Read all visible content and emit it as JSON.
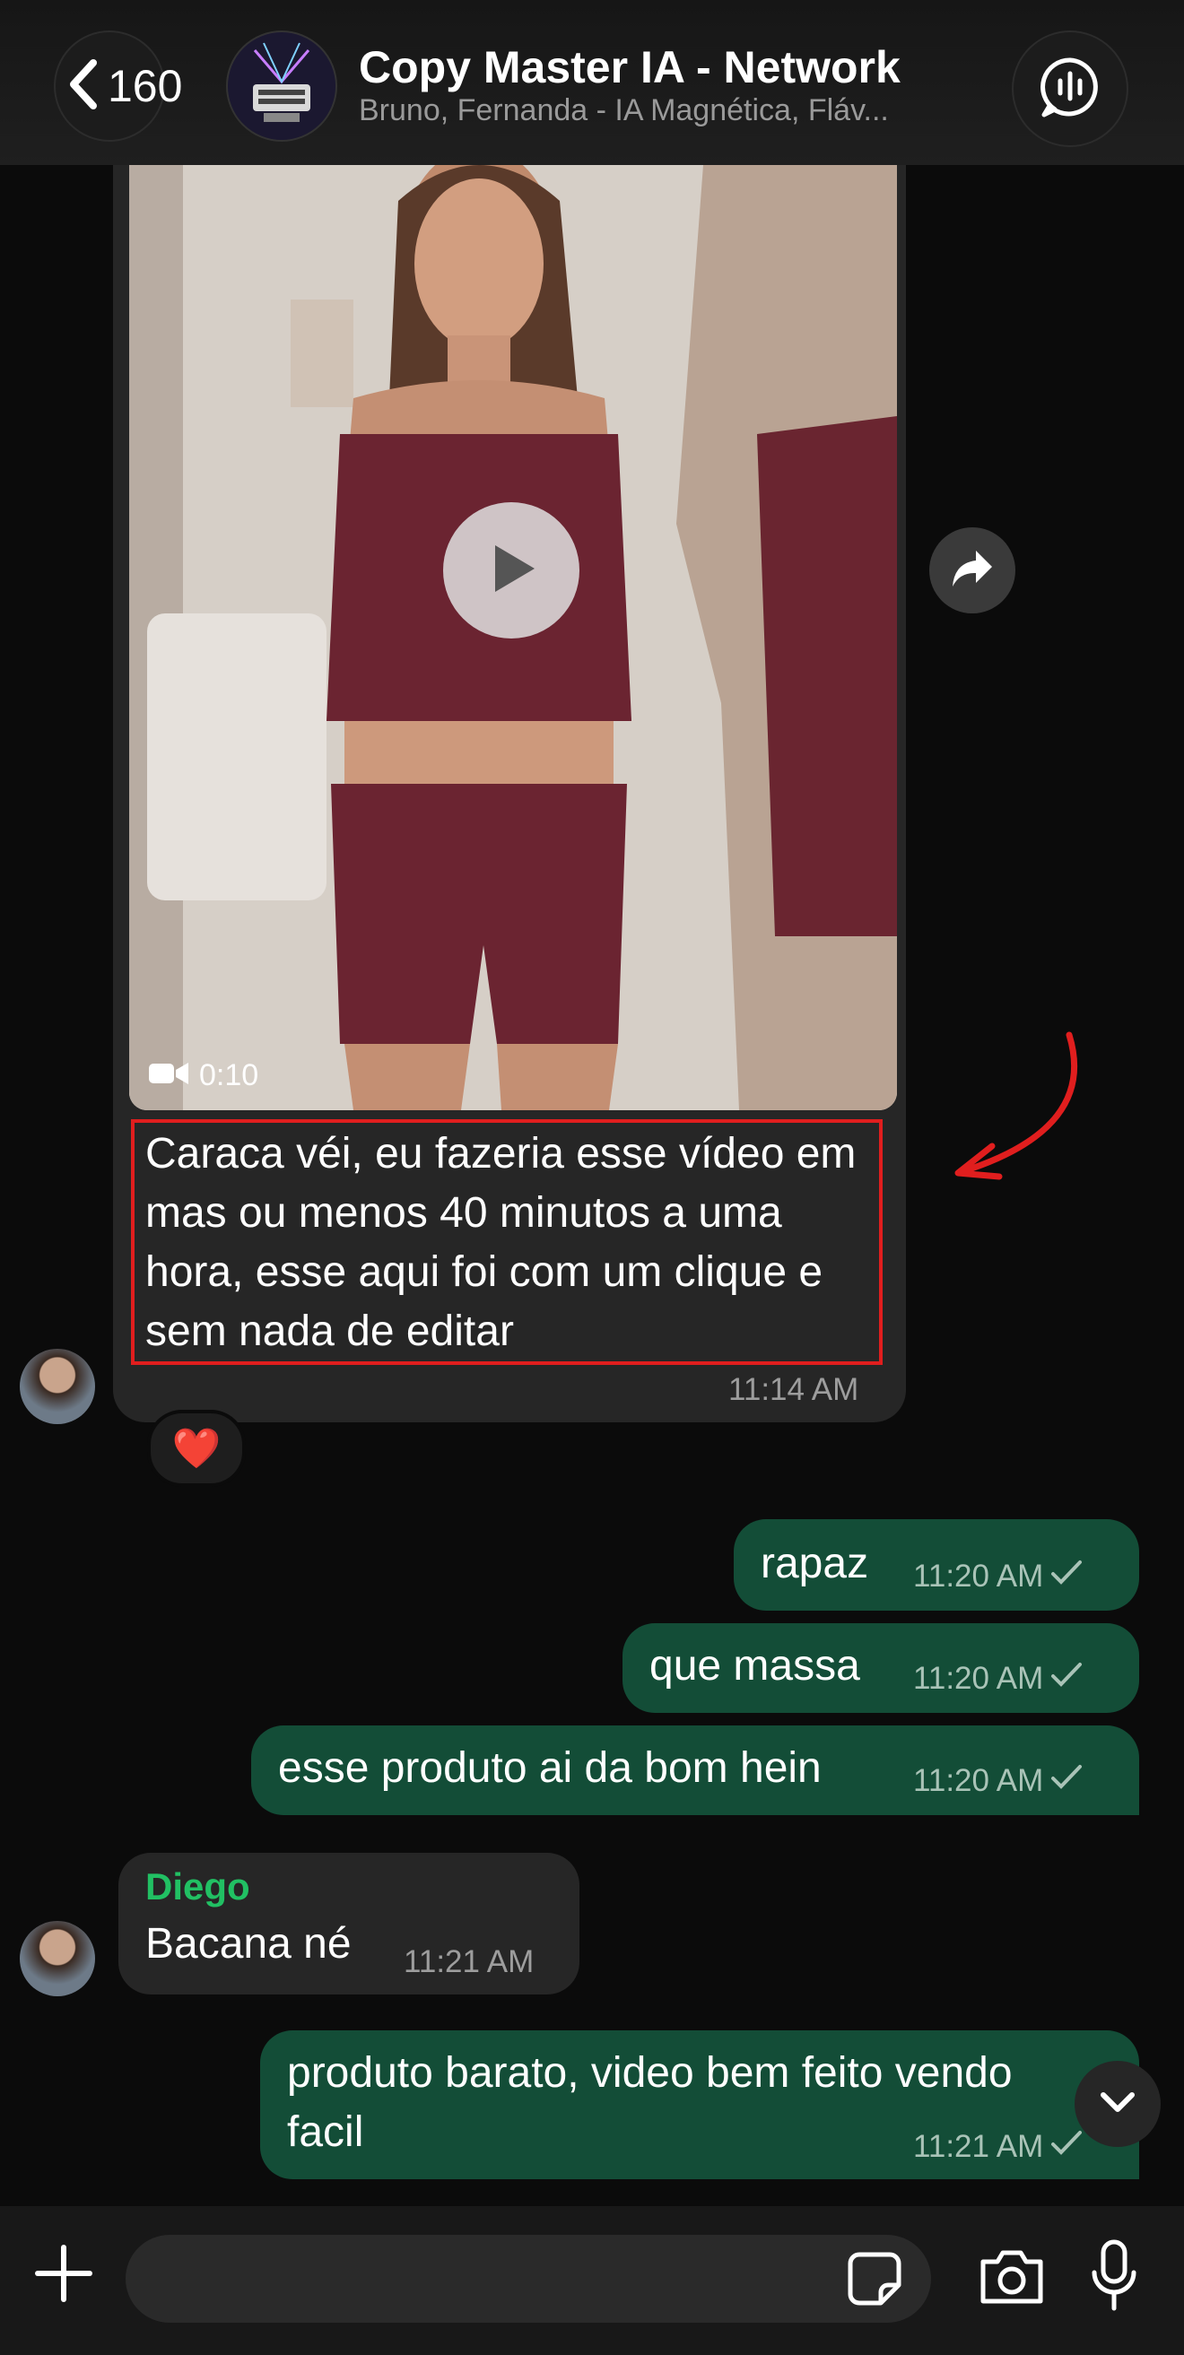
{
  "header": {
    "back_count": "160",
    "title": "Copy Master IA - Network",
    "subtitle": "Bruno, Fernanda - IA Magnética, Fláv..."
  },
  "video_message": {
    "duration": "0:10",
    "caption": "Caraca véi, eu fazeria esse vídeo em mas ou menos 40 minutos a uma hora, esse aqui foi com um clique e sem nada de editar",
    "time": "11:14 AM",
    "reaction": "❤️"
  },
  "outgoing": [
    {
      "text": "rapaz",
      "time": "11:20 AM"
    },
    {
      "text": "que massa",
      "time": "11:20 AM"
    },
    {
      "text": "esse produto ai da bom hein",
      "time": "11:20 AM"
    },
    {
      "text_line1": "produto barato, video bem feito vendo",
      "text_line2": "facil",
      "time": "11:21 AM"
    }
  ],
  "incoming": {
    "sender": "Diego",
    "text": "Bacana né",
    "time": "11:21 AM"
  },
  "colors": {
    "outgoing_bubble": "#134d37",
    "incoming_bubble": "#262626",
    "sender_name": "#21c063",
    "highlight": "#e01e1e"
  },
  "icons": [
    "chevron-left-icon",
    "group-avatar",
    "audio-call-icon",
    "play-icon",
    "video-camera-icon",
    "forward-icon",
    "check-icon",
    "chevron-down-icon",
    "plus-icon",
    "sticker-icon",
    "camera-icon",
    "microphone-icon"
  ]
}
